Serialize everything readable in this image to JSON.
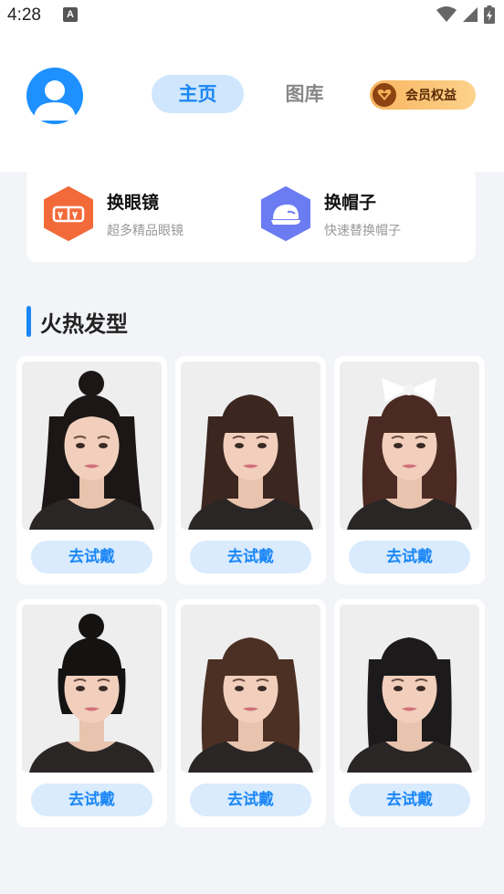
{
  "status_bar": {
    "time": "4:28",
    "a_icon": "A",
    "icons": [
      "wifi-icon",
      "signal-icon",
      "battery-charging-icon"
    ]
  },
  "header": {
    "tabs": [
      {
        "label": "主页",
        "active": true
      },
      {
        "label": "图库",
        "active": false
      }
    ],
    "vip": {
      "label": "会员权益",
      "icon": "heart-icon"
    },
    "avatar_icon": "user-avatar-icon"
  },
  "features": [
    {
      "title": "换眼镜",
      "subtitle": "超多精品眼镜",
      "icon": "glasses-icon",
      "color": "#f26a3a"
    },
    {
      "title": "换帽子",
      "subtitle": "快速替换帽子",
      "icon": "cap-icon",
      "color": "#6b7cf2"
    }
  ],
  "section": {
    "title": "火热发型"
  },
  "hairstyles": [
    {
      "button": "去试戴",
      "hair_color": "#1c1716",
      "style": "long-curly-top-bun"
    },
    {
      "button": "去试戴",
      "hair_color": "#3b2620",
      "style": "long-straight-bangs"
    },
    {
      "button": "去试戴",
      "hair_color": "#4a2a22",
      "style": "wavy-bow"
    },
    {
      "button": "去试戴",
      "hair_color": "#151212",
      "style": "top-bun-bangs"
    },
    {
      "button": "去试戴",
      "hair_color": "#4d3024",
      "style": "long-wavy-bangs"
    },
    {
      "button": "去试戴",
      "hair_color": "#1d1a1c",
      "style": "medium-straight-bangs"
    }
  ],
  "colors": {
    "accent": "#1a86f5",
    "tab_active_bg": "#cfe6fd",
    "button_bg": "#d9ebfd",
    "page_bg": "#f2f4f7"
  }
}
